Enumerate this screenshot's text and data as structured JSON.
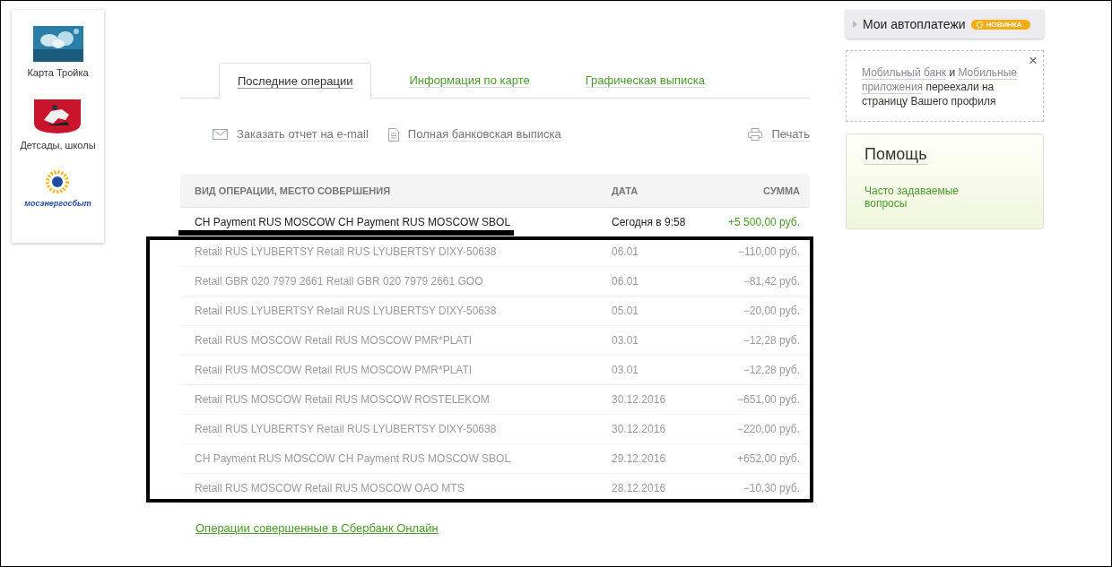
{
  "sidebar": {
    "items": [
      {
        "kind": "troika",
        "label": "Карта Тройка"
      },
      {
        "kind": "coat",
        "label": "Детсады, школы"
      },
      {
        "kind": "energy",
        "label": "мосэнергосбыт"
      }
    ]
  },
  "tabs": [
    {
      "label": "Последние операции",
      "selected": true
    },
    {
      "label": "Информация по карте",
      "selected": false
    },
    {
      "label": "Графическая выписка",
      "selected": false
    }
  ],
  "actions": [
    {
      "kind": "mail",
      "label": "Заказать отчет на e-mail"
    },
    {
      "kind": "doc",
      "label": "Полная банковская выписка"
    },
    {
      "kind": "print",
      "label": "Печать"
    }
  ],
  "table": {
    "columns": [
      "ВИД ОПЕРАЦИИ, МЕСТО СОВЕРШЕНИЯ",
      "ДАТА",
      "СУММА"
    ],
    "rows": [
      {
        "description": "CH Payment RUS MOSCOW CH Payment RUS MOSCOW SBOL",
        "date": "Сегодня в 9:58",
        "amount": "+5 500,00 руб.",
        "income": true,
        "faded": false
      },
      {
        "description": "Retail RUS LYUBERTSY Retail RUS LYUBERTSY DIXY-50638",
        "date": "06.01",
        "amount": "−110,00 руб.",
        "income": false,
        "faded": true
      },
      {
        "description": "Retail GBR 020 7979 2661 Retail GBR 020 7979 2661 GOO",
        "date": "06.01",
        "amount": "−81,42 руб.",
        "income": false,
        "faded": true
      },
      {
        "description": "Retail RUS LYUBERTSY Retail RUS LYUBERTSY DIXY-50638",
        "date": "05.01",
        "amount": "−20,00 руб.",
        "income": false,
        "faded": true
      },
      {
        "description": "Retail RUS MOSCOW Retail RUS MOSCOW PMR*PLATI",
        "date": "03.01",
        "amount": "−12,28 руб.",
        "income": false,
        "faded": true
      },
      {
        "description": "Retail RUS MOSCOW Retail RUS MOSCOW PMR*PLATI",
        "date": "03.01",
        "amount": "−12,28 руб.",
        "income": false,
        "faded": true
      },
      {
        "description": "Retail RUS MOSCOW Retail RUS MOSCOW ROSTELEKOM",
        "date": "30.12.2016",
        "amount": "−651,00 руб.",
        "income": false,
        "faded": true
      },
      {
        "description": "Retail RUS LYUBERTSY Retail RUS LYUBERTSY DIXY-50638",
        "date": "30.12.2016",
        "amount": "−220,00 руб.",
        "income": false,
        "faded": true
      },
      {
        "description": "CH Payment RUS MOSCOW CH Payment RUS MOSCOW SBOL",
        "date": "29.12.2016",
        "amount": "+652,00 руб.",
        "income": true,
        "faded": true
      },
      {
        "description": "Retail RUS MOSCOW Retail RUS MOSCOW OAO MTS",
        "date": "28.12.2016",
        "amount": "−10,30 руб.",
        "income": false,
        "faded": true
      }
    ]
  },
  "footer_link": "Операции совершенные в Сбербанк Онлайн",
  "autopay": {
    "label": "Мои автоплатежи",
    "badge": "НОВИНКА"
  },
  "notice": {
    "segments": [
      {
        "text": "Мобильный банк",
        "kind": "link"
      },
      {
        "text": "и",
        "kind": "text"
      },
      {
        "text": "Мобильные",
        "kind": "link"
      },
      {
        "text": "приложения",
        "kind": "link"
      },
      {
        "text": "переехали на страницу Вашего профиля",
        "kind": "text"
      }
    ],
    "close": "×"
  },
  "help": {
    "title": "Помощь",
    "links": [
      "Часто задаваемые вопросы"
    ]
  }
}
